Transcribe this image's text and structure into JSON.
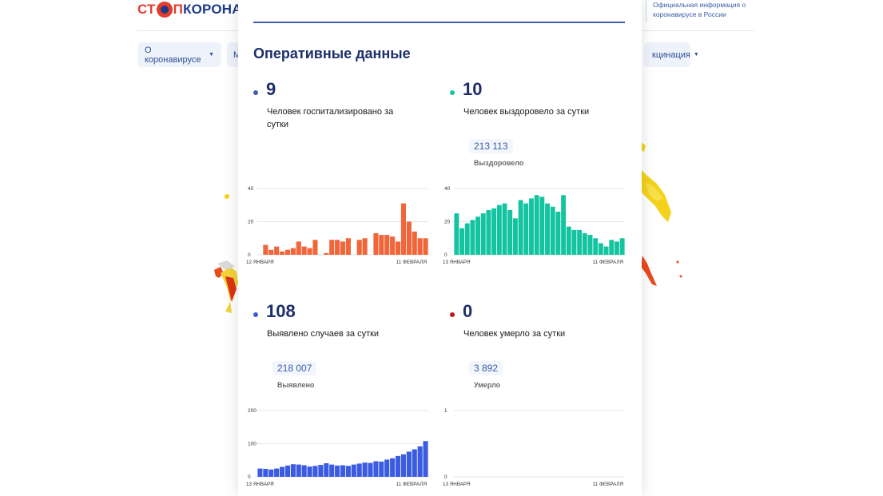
{
  "site": {
    "logo_part1": "СТ",
    "logo_part2": "П",
    "logo_part3": "КОРОНАВ",
    "official_info": "Официальная информация о коронавирусе в России"
  },
  "nav": {
    "item1": "О коронавирусе",
    "item2": "М",
    "item3": "кцинация"
  },
  "panel": {
    "title": "Оперативные данные"
  },
  "stats": {
    "hospitalized": {
      "number": "9",
      "desc": "Человек госпитализировано за сутки",
      "color": "#3f5ea8"
    },
    "recovered": {
      "number": "10",
      "desc": "Человек выздоровело за сутки",
      "total": "213 113",
      "total_label": "Выздоровело",
      "color": "#12c4a0"
    },
    "detected": {
      "number": "108",
      "desc": "Выявлено случаев за сутки",
      "total": "218 007",
      "total_label": "Выявлено",
      "color": "#3b5ce0"
    },
    "died": {
      "number": "0",
      "desc": "Человек умерло за сутки",
      "total": "3 892",
      "total_label": "Умерло",
      "color": "#c0181f"
    }
  },
  "chart_data": [
    {
      "type": "bar",
      "x_start_label": "12 ЯНВАРЯ",
      "x_end_label": "11 ФЕВРАЛЯ",
      "y_ticks": [
        "0",
        "20",
        "40"
      ],
      "ylim": [
        0,
        40
      ],
      "color": "#f0653a",
      "values": [
        0,
        6,
        3,
        5,
        2,
        3,
        4,
        8,
        5,
        4,
        9,
        0,
        1,
        9,
        9,
        8,
        10,
        0,
        9,
        10,
        0,
        13,
        12,
        12,
        11,
        8,
        31,
        20,
        14,
        10,
        10
      ]
    },
    {
      "type": "bar",
      "x_start_label": "13 ЯНВАРЯ",
      "x_end_label": "11 ФЕВРАЛЯ",
      "y_ticks": [
        "0",
        "20",
        "40"
      ],
      "ylim": [
        0,
        40
      ],
      "color": "#12c4a0",
      "values": [
        25,
        16,
        19,
        21,
        23,
        25,
        27,
        28,
        30,
        31,
        27,
        22,
        33,
        31,
        34,
        36,
        35,
        31,
        29,
        26,
        36,
        17,
        15,
        15,
        13,
        12,
        10,
        7,
        5,
        9,
        8,
        10
      ]
    },
    {
      "type": "bar",
      "x_start_label": "13 ЯНВАРЯ",
      "x_end_label": "11 ФЕВРАЛЯ",
      "y_ticks": [
        "0",
        "100",
        "200"
      ],
      "ylim": [
        0,
        200
      ],
      "color": "#3b5ce0",
      "values": [
        25,
        24,
        22,
        25,
        30,
        34,
        38,
        37,
        35,
        31,
        33,
        36,
        41,
        37,
        34,
        35,
        33,
        37,
        40,
        43,
        42,
        47,
        46,
        52,
        56,
        63,
        68,
        76,
        83,
        92,
        108
      ]
    },
    {
      "type": "bar",
      "x_start_label": "13 ЯНВАРЯ",
      "x_end_label": "11 ФЕВРАЛЯ",
      "y_ticks": [
        "0",
        "1"
      ],
      "ylim": [
        0,
        1
      ],
      "color": "#c0181f",
      "values": [
        0,
        0,
        0,
        0,
        0,
        0,
        0,
        0,
        0,
        0,
        0,
        0,
        0,
        0,
        0,
        0,
        0,
        0,
        0,
        0,
        0,
        0,
        0,
        0,
        0,
        0,
        0,
        0,
        0,
        0
      ]
    }
  ]
}
